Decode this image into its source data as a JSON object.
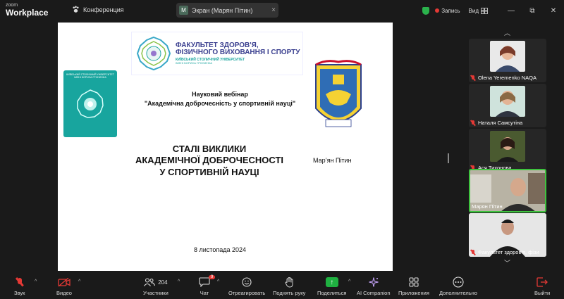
{
  "app": {
    "logo_top": "zoom",
    "logo_bottom": "Workplace",
    "meeting_label": "Конференция"
  },
  "screen_share": {
    "initial": "M",
    "label": "Экран (Марян Пітин)",
    "close": "×"
  },
  "titlebar": {
    "record_label": "Запись",
    "view_label": "Вид",
    "minimize": "—",
    "maximize": "⧉",
    "close": "✕"
  },
  "slide": {
    "faculty_line1": "ФАКУЛЬТЕТ ЗДОРОВ'Я,",
    "faculty_line2": "ФІЗИЧНОГО ВИХОВАННЯ І СПОРТУ",
    "faculty_line3": "КИЇВСЬКИЙ СТОЛИЧНИЙ УНІВЕРСИТЕТ",
    "faculty_line4": "ІМЕНІ БОРИСА ГРІНЧЕНКА",
    "univ_logo_text": "КИЇВСЬКИЙ СТОЛИЧНИЙ УНІВЕРСИТЕТ ІМЕНІ БОРИСА ГРІНЧЕНКА",
    "webinar_line1": "Науковий вебінар",
    "webinar_line2": "\"Академічна доброчесність у спортивній науці\"",
    "title_line1": "СТАЛІ ВИКЛИКИ",
    "title_line2": "АКАДЕМІЧНОЇ ДОБРОЧЕСНОСТІ",
    "title_line3": "У СПОРТИВНІЙ НАУЦІ",
    "author": "Мар’ян Пітин",
    "date": "8 листопада 2024"
  },
  "participants": [
    {
      "name": "Olena Yeremenko NAQA",
      "muted": true,
      "active": false
    },
    {
      "name": "Наталя Самсутіна",
      "muted": true,
      "active": false
    },
    {
      "name": "Ася Тихонова",
      "muted": true,
      "active": false
    },
    {
      "name": "Марян Пітин",
      "muted": false,
      "active": true
    },
    {
      "name": "Факультет здоров'я, фізи",
      "muted": true,
      "active": false
    }
  ],
  "toolbar": {
    "audio": "Звук",
    "video": "Видео",
    "participants": "Участники",
    "participants_count": "204",
    "chat": "Чат",
    "chat_badge": "9",
    "react": "Отреагировать",
    "raise_hand": "Поднять руку",
    "share": "Поделиться",
    "ai": "AI Companion",
    "apps": "Приложения",
    "more": "Дополнительно",
    "leave": "Выйти"
  },
  "colors": {
    "accent_green": "#1fb141",
    "danger_red": "#e53935",
    "teal": "#18a59e",
    "faculty_blue": "#3a3f8f"
  }
}
